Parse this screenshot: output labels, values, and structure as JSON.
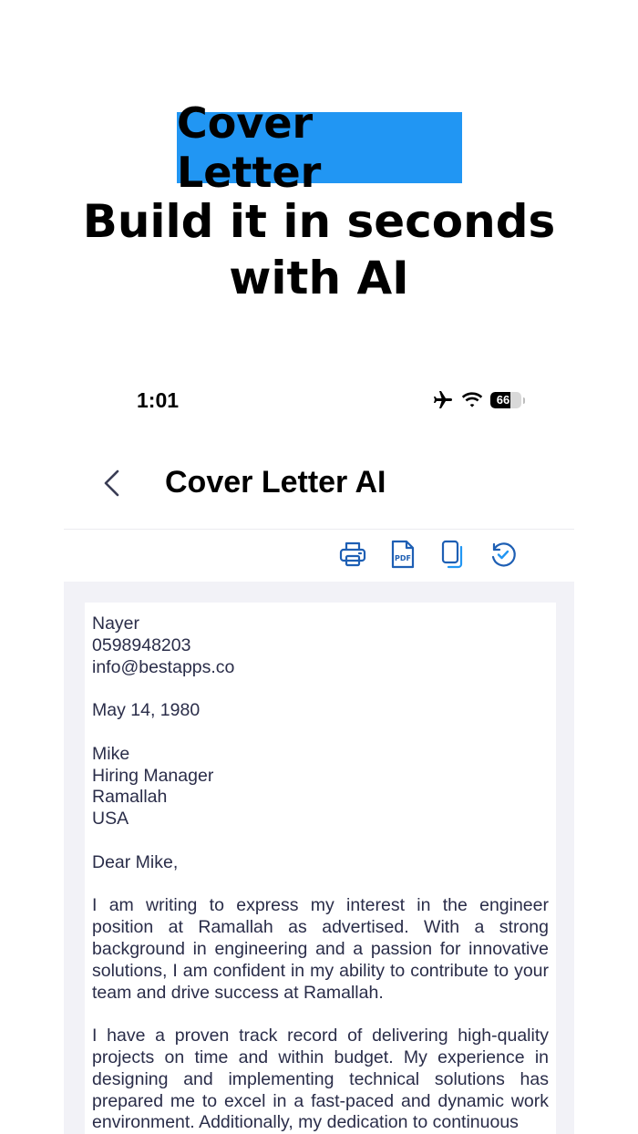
{
  "promo": {
    "badge": "Cover Letter",
    "headline": "Build it in seconds with AI"
  },
  "status_bar": {
    "time": "1:01",
    "battery": "66",
    "battery_level": 0.66,
    "icons": [
      "airplane-icon",
      "wifi-icon",
      "battery-icon"
    ]
  },
  "nav": {
    "back_icon": "chevron-left-icon",
    "title": "Cover Letter AI"
  },
  "toolbar": {
    "accent": "#1e5fb4",
    "buttons": [
      "printer-icon",
      "pdf-icon",
      "copy-icon",
      "history-icon"
    ]
  },
  "letter": {
    "sender": [
      "Nayer",
      "0598948203",
      "info@bestapps.co"
    ],
    "date": "May 14, 1980",
    "recipient": [
      "Mike",
      "Hiring Manager",
      "Ramallah",
      "USA"
    ],
    "greeting": "Dear Mike,",
    "paragraphs": [
      "I am writing to express my interest in the engineer position at Ramallah as advertised. With a strong background in engineering and a passion for innovative solutions, I am confident in my ability to contribute to your team and drive success at Ramallah.",
      "I have a proven track record of delivering high-quality projects on time and within budget. My experience in designing and implementing technical solutions has prepared me to excel in a fast-paced and dynamic work environment. Additionally, my dedication to continuous"
    ]
  }
}
